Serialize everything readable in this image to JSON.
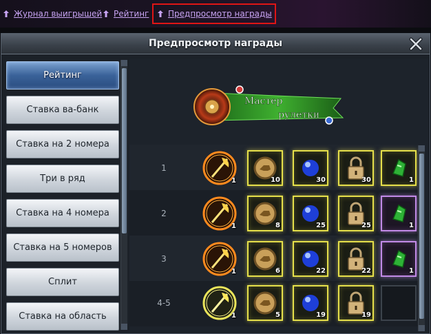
{
  "topbar": {
    "links": [
      {
        "label": "Журнал выигрышей",
        "icon": "heart-arrow-icon"
      },
      {
        "label": "Рейтинг",
        "icon": "heart-arrow-icon"
      },
      {
        "label": "Предпросмотр награды",
        "icon": "heart-arrow-icon",
        "highlighted": true
      }
    ]
  },
  "window": {
    "title": "Предпросмотр награды",
    "close_icon": "close-x-icon"
  },
  "sidebar": {
    "items": [
      {
        "label": "Рейтинг",
        "active": true
      },
      {
        "label": "Ставка ва-банк"
      },
      {
        "label": "Ставка на 2 номера"
      },
      {
        "label": "Три в ряд"
      },
      {
        "label": "Ставка на 4 номера"
      },
      {
        "label": "Ставка на 5 номеров"
      },
      {
        "label": "Сплит"
      },
      {
        "label": "Ставка на область"
      }
    ]
  },
  "banner": {
    "line1": "Мастер",
    "line2": "рулетки",
    "icon": "roulette-wheel-icon"
  },
  "rewards": {
    "rows": [
      {
        "rank": "1",
        "items": [
          {
            "icon": "golden-axe-icon",
            "count": "1",
            "frame": "orange"
          },
          {
            "icon": "horse-coin-icon",
            "count": "10",
            "frame": "gold"
          },
          {
            "icon": "blue-orb-icon",
            "count": "30",
            "frame": "gold"
          },
          {
            "icon": "padlock-icon",
            "count": "30",
            "frame": "gold"
          },
          {
            "icon": "green-gem-icon",
            "count": "1",
            "frame": "gold"
          }
        ]
      },
      {
        "rank": "2",
        "items": [
          {
            "icon": "golden-axe-icon",
            "count": "1",
            "frame": "orange"
          },
          {
            "icon": "horse-coin-icon",
            "count": "8",
            "frame": "gold"
          },
          {
            "icon": "blue-orb-icon",
            "count": "25",
            "frame": "gold"
          },
          {
            "icon": "padlock-icon",
            "count": "25",
            "frame": "gold"
          },
          {
            "icon": "green-gem-icon",
            "count": "1",
            "frame": "purple"
          }
        ]
      },
      {
        "rank": "3",
        "items": [
          {
            "icon": "golden-axe-icon",
            "count": "1",
            "frame": "orange"
          },
          {
            "icon": "horse-coin-icon",
            "count": "6",
            "frame": "gold"
          },
          {
            "icon": "blue-orb-icon",
            "count": "22",
            "frame": "gold"
          },
          {
            "icon": "padlock-icon",
            "count": "22",
            "frame": "gold"
          },
          {
            "icon": "green-gem-icon",
            "count": "1",
            "frame": "purple"
          }
        ]
      },
      {
        "rank": "4-5",
        "items": [
          {
            "icon": "golden-axe-icon",
            "count": "1",
            "frame": "yellow"
          },
          {
            "icon": "horse-coin-icon",
            "count": "5",
            "frame": "gold"
          },
          {
            "icon": "blue-orb-icon",
            "count": "19",
            "frame": "gold"
          },
          {
            "icon": "padlock-icon",
            "count": "19",
            "frame": "gold"
          },
          {
            "icon": "empty-slot",
            "count": "",
            "frame": "empty"
          }
        ]
      }
    ]
  },
  "colors": {
    "link": "#c7a3f2",
    "highlight_box": "#e01515",
    "active_tab": "#3a6299",
    "gold_frame": "#e5df4a",
    "purple_frame": "#c18ae6"
  }
}
